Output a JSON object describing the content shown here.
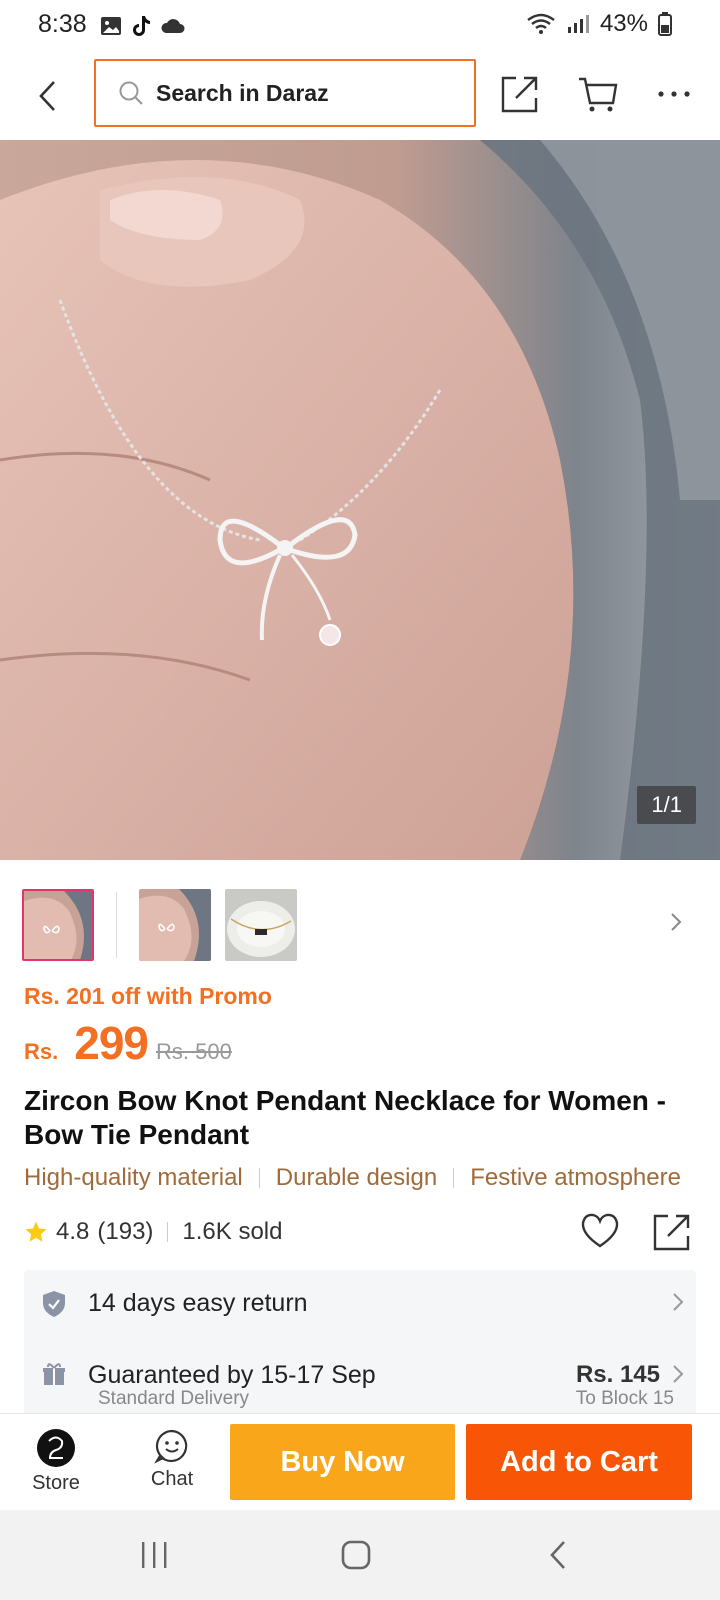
{
  "status_bar": {
    "time": "8:38",
    "battery": "43%"
  },
  "search": {
    "placeholder": "Search in Daraz"
  },
  "gallery": {
    "counter": "1/1"
  },
  "product": {
    "promo": "Rs. 201 off with Promo",
    "currency": "Rs.",
    "price": "299",
    "original_price": "Rs. 500",
    "title": "Zircon Bow Knot Pendant Necklace for Women - Bow Tie Pendant",
    "tags": [
      "High-quality material",
      "Durable design",
      "Festive atmosphere"
    ],
    "rating": "4.8",
    "reviews": "(193)",
    "sold": "1.6K sold"
  },
  "services": {
    "return": "14 days easy return",
    "delivery": "Guaranteed by 15-17 Sep",
    "delivery_type": "Standard Delivery",
    "delivery_price": "Rs. 145",
    "delivery_to": "To Block 15"
  },
  "actions": {
    "store": "Store",
    "chat": "Chat",
    "buy_now": "Buy Now",
    "add_to_cart": "Add to Cart"
  },
  "colors": {
    "brand": "#f85606",
    "buy": "#faa61a",
    "promo": "#f36f21",
    "tag": "#a06b3b"
  },
  "icons": [
    "back-icon",
    "search-icon",
    "share-icon",
    "cart-icon",
    "more-icon",
    "star-icon",
    "heart-icon",
    "shield-icon",
    "gift-icon",
    "chat-icon"
  ]
}
